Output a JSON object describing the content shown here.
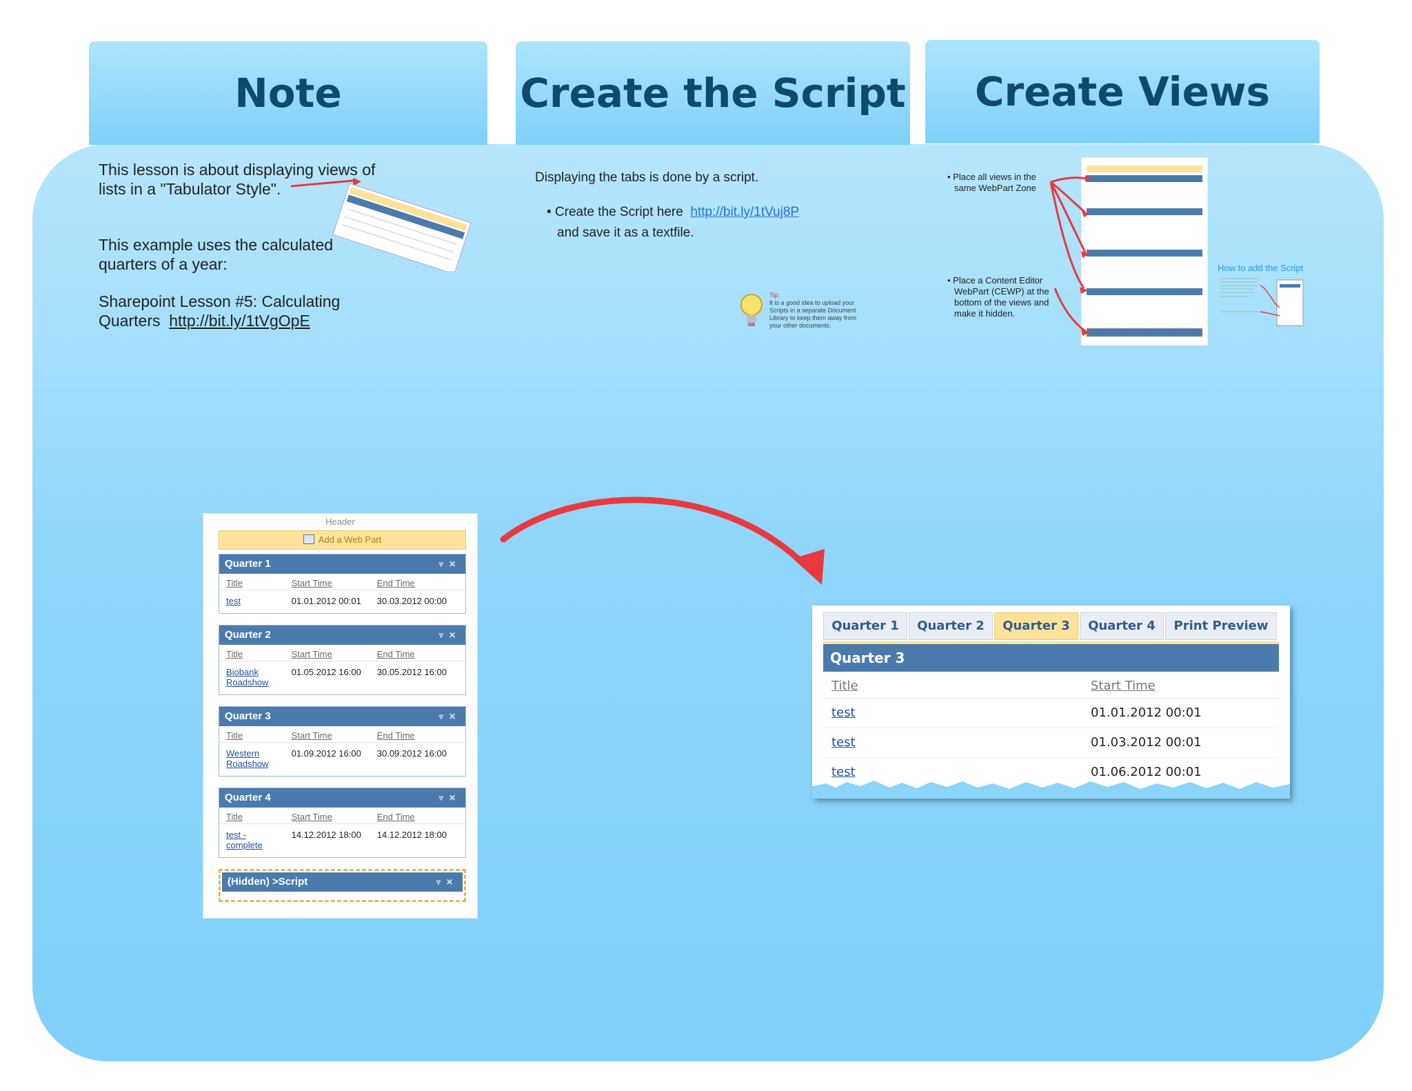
{
  "tabs": {
    "note": "Note",
    "script": "Create the Script",
    "views": "Create Views"
  },
  "note": {
    "para1_line1": "This lesson is about displaying views of",
    "para1_line2": "lists in a \"Tabulator Style\".",
    "para2_line1": "This example uses the calculated",
    "para2_line2": "quarters of a year:",
    "para3_line1": "Sharepoint Lesson #5: Calculating",
    "para3_prefix": "Quarters",
    "para3_link": "http://bit.ly/1tVgOpE"
  },
  "script": {
    "intro": "Displaying the tabs is done by a script.",
    "bullet_prefix": "• Create the Script here",
    "bullet_link": "http://bit.ly/1tVuj8P",
    "bullet_suffix": "and save it as a textfile.",
    "tip_title": "Tip:",
    "tip_body": "It is a good idea to upload your Scripts in a separate Document Library to keep them away from your other documents."
  },
  "views": {
    "bullet1_line1": "• Place all views in the",
    "bullet1_line2": "same WebPart Zone",
    "bullet2_line1": "• Place a Content Editor",
    "bullet2_line2": "WebPart (CEWP) at the",
    "bullet2_line3": "bottom of the views and",
    "bullet2_line4": "make it hidden.",
    "how_to": "How to add the Script"
  },
  "webpart": {
    "header": "Header",
    "add": "Add a Web Part",
    "col_title": "Title",
    "col_start": "Start Time",
    "col_end": "End Time",
    "q1": {
      "name": "Quarter 1",
      "title": "test",
      "start": "01.01.2012 00:01",
      "end": "30.03.2012 00:00"
    },
    "q2": {
      "name": "Quarter 2",
      "title_l1": "Biobank",
      "title_l2": "Roadshow",
      "start": "01.05.2012 16:00",
      "end": "30.05.2012 16:00"
    },
    "q3": {
      "name": "Quarter 3",
      "title_l1": "Western",
      "title_l2": "Roadshow",
      "start": "01.09.2012 16:00",
      "end": "30.09.2012 16:00"
    },
    "q4": {
      "name": "Quarter 4",
      "title_l1": "test -",
      "title_l2": "complete",
      "start": "14.12.2012 18:00",
      "end": "14.12.2012 18:00"
    },
    "hidden": "(Hidden) >Script"
  },
  "tabview": {
    "tab1": "Quarter 1",
    "tab2": "Quarter 2",
    "tab3": "Quarter 3",
    "tab4": "Quarter 4",
    "tab5": "Print Preview",
    "bar": "Quarter 3",
    "col_title": "Title",
    "col_start": "Start Time",
    "rows": [
      {
        "title": "test",
        "start": "01.01.2012 00:01"
      },
      {
        "title": "test",
        "start": "01.03.2012 00:01"
      },
      {
        "title": "test",
        "start": "01.06.2012 00:01"
      }
    ]
  },
  "colors": {
    "board": "#8fd6fb",
    "tab_text": "#0d4a6b",
    "arrow": "#e8393f",
    "bar": "#4b7bad",
    "active_tab": "#fde39a"
  }
}
